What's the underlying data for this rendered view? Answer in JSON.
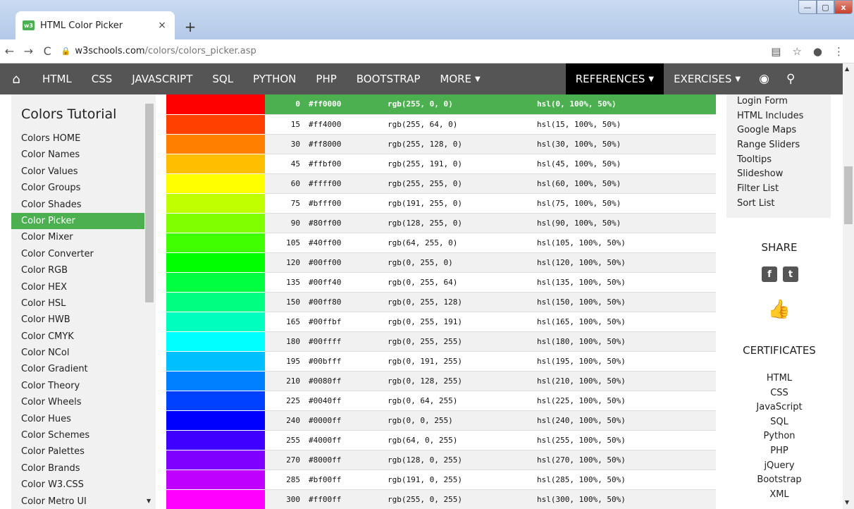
{
  "browser": {
    "tab_title": "HTML Color Picker",
    "tab_favicon": "w3",
    "tab_close": "×",
    "new_tab": "+",
    "win_min": "—",
    "win_max": "▢",
    "win_close": "x",
    "back": "←",
    "forward": "→",
    "reload": "C",
    "url_host": "w3schools.com",
    "url_path": "/colors/colors_picker.asp",
    "translate_icon": "▤",
    "star_icon": "☆",
    "account_icon": "●",
    "menu_icon": "⋮"
  },
  "nav": {
    "home_icon": "⌂",
    "items": [
      "HTML",
      "CSS",
      "JAVASCRIPT",
      "SQL",
      "PYTHON",
      "PHP",
      "BOOTSTRAP"
    ],
    "more": "MORE",
    "references": "REFERENCES",
    "exercises": "EXERCISES",
    "dropdown_arrow": "▼",
    "globe_icon": "◉",
    "search_icon": "⚲"
  },
  "sidebar": {
    "title": "Colors Tutorial",
    "links": [
      "Colors HOME",
      "Color Names",
      "Color Values",
      "Color Groups",
      "Color Shades",
      "Color Picker",
      "Color Mixer",
      "Color Converter",
      "Color RGB",
      "Color HEX",
      "Color HSL",
      "Color HWB",
      "Color CMYK",
      "Color NCol",
      "Color Gradient",
      "Color Theory",
      "Color Wheels",
      "Color Hues",
      "Color Schemes",
      "Color Palettes",
      "Color Brands",
      "Color W3.CSS",
      "Color Metro UI"
    ],
    "active_index": 5,
    "scroll_down": "▼"
  },
  "color_table": {
    "selected_index": 0,
    "rows": [
      {
        "deg": "0",
        "hex": "#ff0000",
        "rgb": "rgb(255, 0, 0)",
        "hsl": "hsl(0, 100%, 50%)",
        "color": "#ff0000"
      },
      {
        "deg": "15",
        "hex": "#ff4000",
        "rgb": "rgb(255, 64, 0)",
        "hsl": "hsl(15, 100%, 50%)",
        "color": "#ff4000"
      },
      {
        "deg": "30",
        "hex": "#ff8000",
        "rgb": "rgb(255, 128, 0)",
        "hsl": "hsl(30, 100%, 50%)",
        "color": "#ff8000"
      },
      {
        "deg": "45",
        "hex": "#ffbf00",
        "rgb": "rgb(255, 191, 0)",
        "hsl": "hsl(45, 100%, 50%)",
        "color": "#ffbf00"
      },
      {
        "deg": "60",
        "hex": "#ffff00",
        "rgb": "rgb(255, 255, 0)",
        "hsl": "hsl(60, 100%, 50%)",
        "color": "#ffff00"
      },
      {
        "deg": "75",
        "hex": "#bfff00",
        "rgb": "rgb(191, 255, 0)",
        "hsl": "hsl(75, 100%, 50%)",
        "color": "#bfff00"
      },
      {
        "deg": "90",
        "hex": "#80ff00",
        "rgb": "rgb(128, 255, 0)",
        "hsl": "hsl(90, 100%, 50%)",
        "color": "#80ff00"
      },
      {
        "deg": "105",
        "hex": "#40ff00",
        "rgb": "rgb(64, 255, 0)",
        "hsl": "hsl(105, 100%, 50%)",
        "color": "#40ff00"
      },
      {
        "deg": "120",
        "hex": "#00ff00",
        "rgb": "rgb(0, 255, 0)",
        "hsl": "hsl(120, 100%, 50%)",
        "color": "#00ff00"
      },
      {
        "deg": "135",
        "hex": "#00ff40",
        "rgb": "rgb(0, 255, 64)",
        "hsl": "hsl(135, 100%, 50%)",
        "color": "#00ff40"
      },
      {
        "deg": "150",
        "hex": "#00ff80",
        "rgb": "rgb(0, 255, 128)",
        "hsl": "hsl(150, 100%, 50%)",
        "color": "#00ff80"
      },
      {
        "deg": "165",
        "hex": "#00ffbf",
        "rgb": "rgb(0, 255, 191)",
        "hsl": "hsl(165, 100%, 50%)",
        "color": "#00ffbf"
      },
      {
        "deg": "180",
        "hex": "#00ffff",
        "rgb": "rgb(0, 255, 255)",
        "hsl": "hsl(180, 100%, 50%)",
        "color": "#00ffff"
      },
      {
        "deg": "195",
        "hex": "#00bfff",
        "rgb": "rgb(0, 191, 255)",
        "hsl": "hsl(195, 100%, 50%)",
        "color": "#00bfff"
      },
      {
        "deg": "210",
        "hex": "#0080ff",
        "rgb": "rgb(0, 128, 255)",
        "hsl": "hsl(210, 100%, 50%)",
        "color": "#0080ff"
      },
      {
        "deg": "225",
        "hex": "#0040ff",
        "rgb": "rgb(0, 64, 255)",
        "hsl": "hsl(225, 100%, 50%)",
        "color": "#0040ff"
      },
      {
        "deg": "240",
        "hex": "#0000ff",
        "rgb": "rgb(0, 0, 255)",
        "hsl": "hsl(240, 100%, 50%)",
        "color": "#0000ff"
      },
      {
        "deg": "255",
        "hex": "#4000ff",
        "rgb": "rgb(64, 0, 255)",
        "hsl": "hsl(255, 100%, 50%)",
        "color": "#4000ff"
      },
      {
        "deg": "270",
        "hex": "#8000ff",
        "rgb": "rgb(128, 0, 255)",
        "hsl": "hsl(270, 100%, 50%)",
        "color": "#8000ff"
      },
      {
        "deg": "285",
        "hex": "#bf00ff",
        "rgb": "rgb(191, 0, 255)",
        "hsl": "hsl(285, 100%, 50%)",
        "color": "#bf00ff"
      },
      {
        "deg": "300",
        "hex": "#ff00ff",
        "rgb": "rgb(255, 0, 255)",
        "hsl": "hsl(300, 100%, 50%)",
        "color": "#ff00ff"
      }
    ]
  },
  "right_column": {
    "more_links": [
      "Login Form",
      "HTML Includes",
      "Google Maps",
      "Range Sliders",
      "Tooltips",
      "Slideshow",
      "Filter List",
      "Sort List"
    ],
    "share_title": "SHARE",
    "facebook_icon": "f",
    "twitter_icon": "t",
    "like_icon": "👍",
    "certificates_title": "CERTIFICATES",
    "certificates": [
      "HTML",
      "CSS",
      "JavaScript",
      "SQL",
      "Python",
      "PHP",
      "jQuery",
      "Bootstrap",
      "XML"
    ]
  },
  "scrollbar": {
    "up": "▲",
    "down": "▼"
  },
  "colors": {
    "accent": "#4caf50",
    "nav_bg": "#555555",
    "nav_active": "#000000",
    "sidebar_bg": "#f1f1f1"
  }
}
